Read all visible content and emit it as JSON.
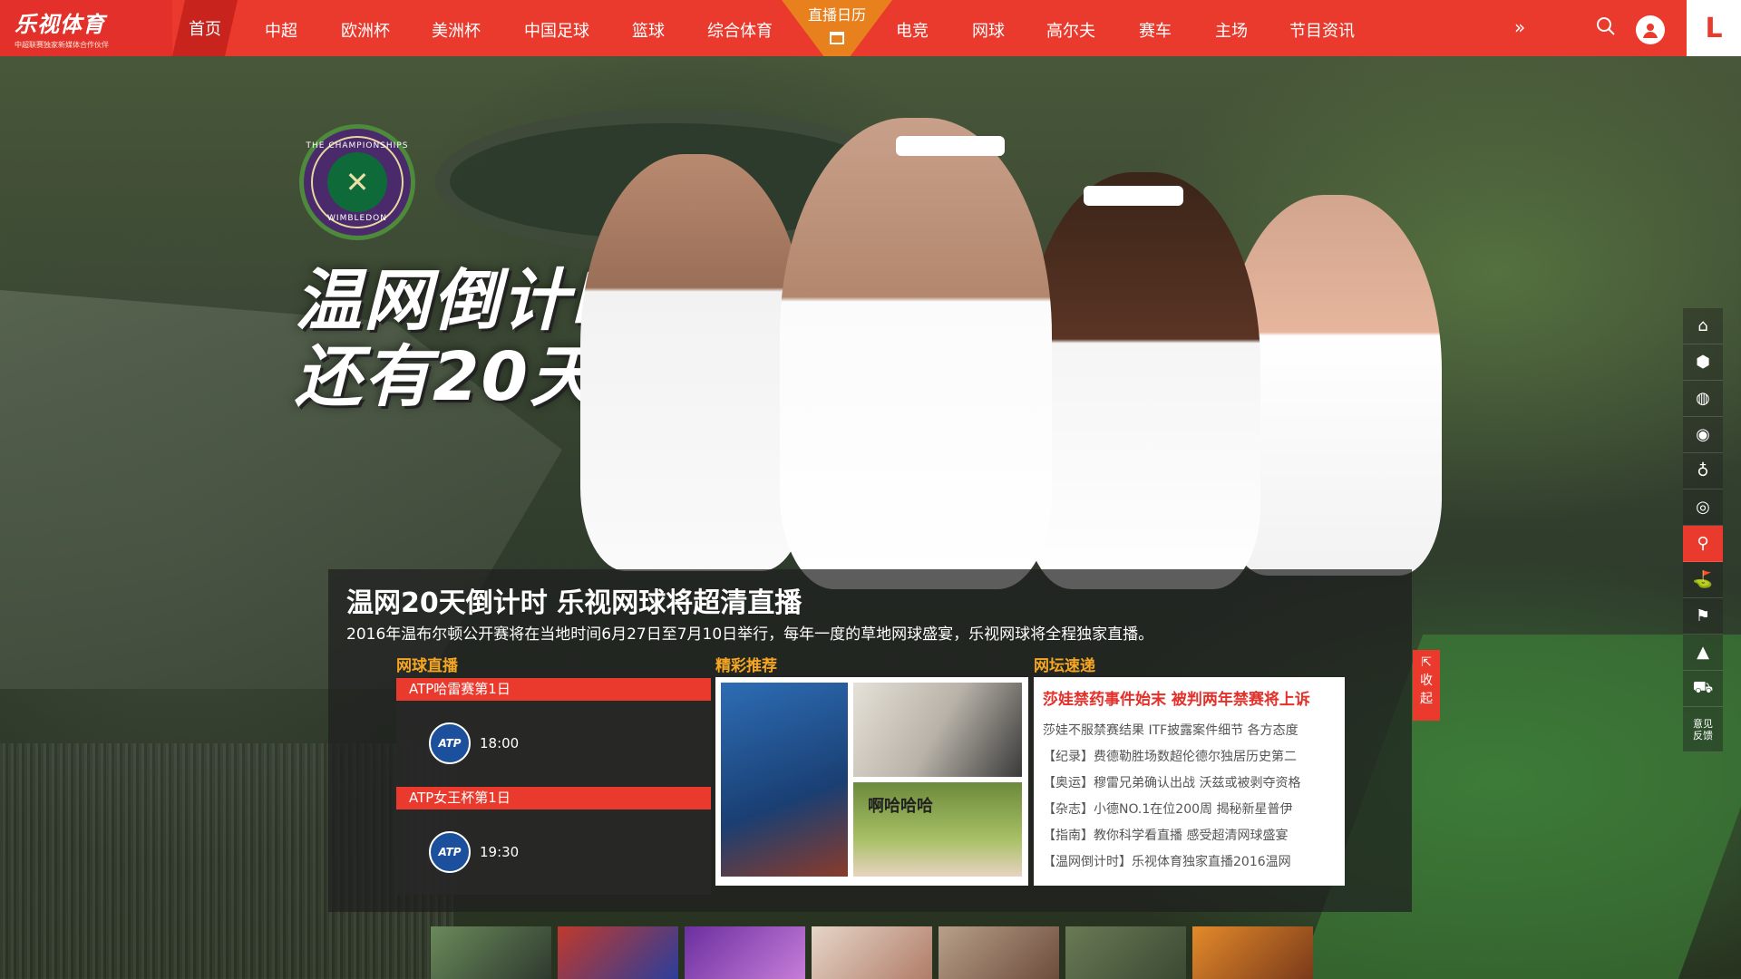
{
  "header": {
    "brand": "乐视体育",
    "brand_tag": "中超联赛独家新媒体合作伙伴",
    "nav": [
      "首页",
      "中超",
      "欧洲杯",
      "美洲杯",
      "中国足球",
      "篮球",
      "综合体育",
      "直播日历",
      "电竞",
      "网球",
      "高尔夫",
      "赛车",
      "主场",
      "节目资讯"
    ],
    "more": "»",
    "app_logo": "L"
  },
  "hero": {
    "badge_top": "THE CHAMPIONSHIPS",
    "badge_bottom": "WIMBLEDON",
    "countdown_line1": "温网倒计时",
    "countdown_line2": "还有20天!",
    "title": "温网20天倒计时 乐视网球将超清直播",
    "desc": "2016年温布尔顿公开赛将在当地时间6月27日至7月10日举行，每年一度的草地网球盛宴，乐视网球将全程独家直播。"
  },
  "sections": {
    "live": "网球直播",
    "recommend": "精彩推荐",
    "news": "网坛速递"
  },
  "live": [
    {
      "event": "ATP哈雷赛第1日",
      "logo": "ATP",
      "time": "18:00"
    },
    {
      "event": "ATP女王杯第1日",
      "logo": "ATP",
      "time": "19:30"
    }
  ],
  "recommend": {
    "caption": "啊哈哈哈"
  },
  "news": {
    "headline": "莎娃禁药事件始末 被判两年禁赛将上诉",
    "items": [
      "莎娃不服禁赛结果 ITF披露案件细节 各方态度",
      "【纪录】费德勒胜场数超伦德尔独居历史第二",
      "【奥运】穆雷兄弟确认出战 沃兹或被剥夺资格",
      "【杂志】小德NO.1在位200周 揭秘新星普伊",
      "【指南】教你科学看直播 感受超清网球盛宴",
      "【温网倒计时】乐视体育独家直播2016温网"
    ],
    "collapse": "收起"
  },
  "sidebar": {
    "feedback": "意见反馈"
  },
  "colors": {
    "brand_red": "#ea3a2d",
    "accent_orange": "#e8801e",
    "section_title": "#f5a623"
  }
}
